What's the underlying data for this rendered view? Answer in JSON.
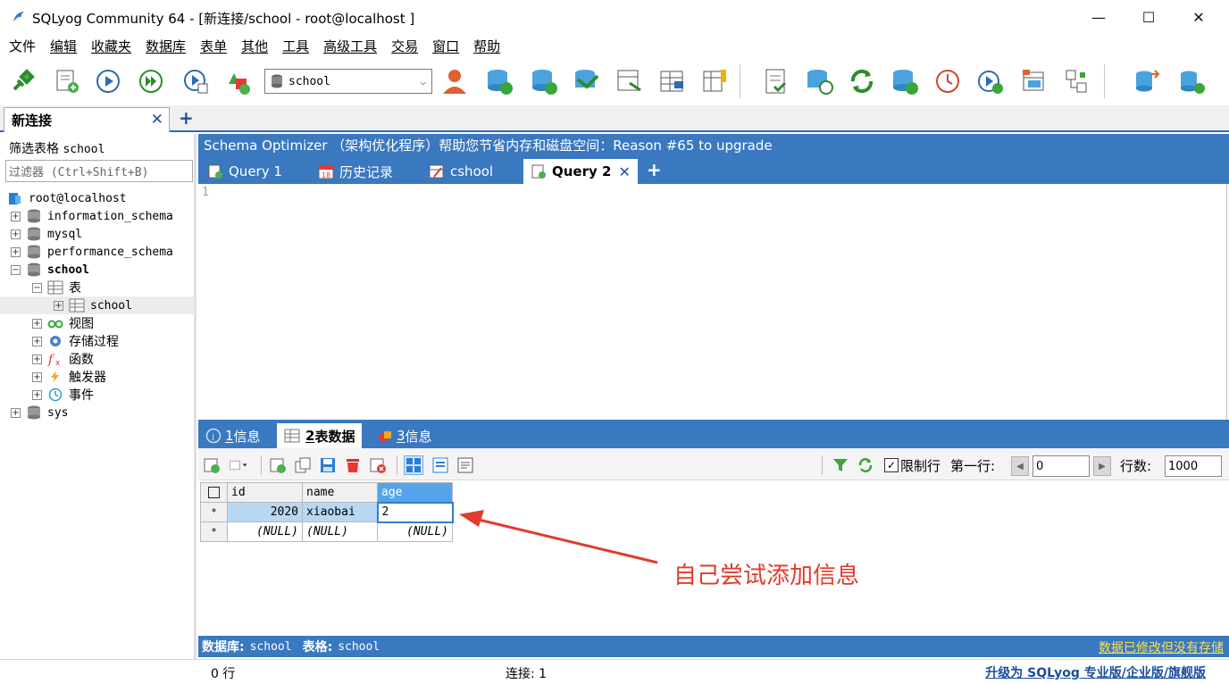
{
  "window": {
    "title": "SQLyog Community 64 - [新连接/school - root@localhost ]",
    "min_glyph": "—",
    "max_glyph": "☐",
    "close_glyph": "✕"
  },
  "menu": [
    "文件",
    "编辑",
    "收藏夹",
    "数据库",
    "表单",
    "其他",
    "工具",
    "高级工具",
    "交易",
    "窗口",
    "帮助"
  ],
  "toolbar": {
    "database_select": "school",
    "icons": [
      "connect-icon",
      "new-query-icon",
      "execute-icon",
      "execute-all-icon",
      "execute-edit-icon",
      "schema-designer-icon",
      "user-manager-icon",
      "backup-db-icon",
      "restore-db-icon",
      "import-icon",
      "export-icon",
      "table-data-icon",
      "table-export-icon",
      "sql-sync-icon",
      "data-sync-icon",
      "schema-sync-icon",
      "job-agent-icon",
      "scheduled-backup-icon",
      "query-builder-icon",
      "data-search-icon",
      "import-external-icon",
      "migrate-icon"
    ]
  },
  "connection_tab": {
    "label": "新连接",
    "close": "✕",
    "add": "+"
  },
  "left": {
    "filter_label": "筛选表格",
    "filter_db": "school",
    "filter_placeholder": "过滤器 (Ctrl+Shift+B)",
    "tree": {
      "root": "root@localhost",
      "dbs": [
        "information_schema",
        "mysql",
        "performance_schema"
      ],
      "current_db": "school",
      "tables_folder": "表",
      "table": "school",
      "views": "视图",
      "procs": "存储过程",
      "funcs": "函数",
      "triggers": "触发器",
      "events": "事件",
      "sys": "sys"
    }
  },
  "schema_banner": "Schema Optimizer （架构优化程序）帮助您节省内存和磁盘空间：Reason #65 to upgrade",
  "query_tabs": [
    {
      "label": "Query 1"
    },
    {
      "label": "历史记录"
    },
    {
      "label": "cshool"
    },
    {
      "label": "Query 2",
      "close": "✕"
    }
  ],
  "query_add": "+",
  "editor": {
    "line": "1"
  },
  "result_tabs": [
    {
      "num": "1",
      "label": " 信息"
    },
    {
      "num": "2",
      "label": " 表数据"
    },
    {
      "num": "3",
      "label": " 信息"
    }
  ],
  "result_toolbar": {
    "limit_label": "限制行",
    "first_row_label": "第一行:",
    "first_row_value": "0",
    "rows_label": "行数:",
    "rows_value": "1000",
    "prev": "◀",
    "next": "▶"
  },
  "grid": {
    "columns": [
      "id",
      "name",
      "age"
    ],
    "rows": [
      {
        "marker": "*",
        "id": "2020",
        "name": "xiaobai",
        "age": "2"
      },
      {
        "marker": "*",
        "id": "(NULL)",
        "name": "(NULL)",
        "age": "(NULL)"
      }
    ]
  },
  "annotation": "自己尝试添加信息",
  "info_bar": {
    "db_label": "数据库:",
    "db_value": "school",
    "table_label": "表格:",
    "table_value": "school",
    "warning": "数据已修改但没有存储"
  },
  "status": {
    "rows": "0 行",
    "connections": "连接: 1",
    "upgrade": "升级为 SQLyog 专业版/企业版/旗舰版"
  }
}
